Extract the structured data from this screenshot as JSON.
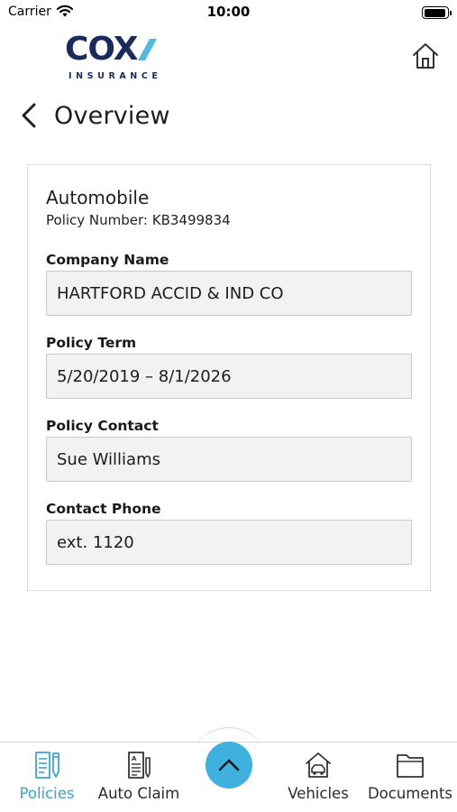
{
  "status_bar": {
    "carrier": "Carrier",
    "time": "10:00"
  },
  "brand": {
    "name": "COX",
    "sub": "INSURANCE",
    "primary_color": "#1b2a5e",
    "accent_color": "#3fb1de"
  },
  "header": {
    "back_icon": "chevron-left-icon",
    "title": "Overview",
    "home_icon": "home-icon"
  },
  "policy": {
    "type": "Automobile",
    "number_label": "Policy Number:",
    "number": "KB3499834",
    "fields": [
      {
        "label": "Company Name",
        "value": "HARTFORD ACCID & IND CO"
      },
      {
        "label": "Policy Term",
        "value": "5/20/2019 – 8/1/2026"
      },
      {
        "label": "Policy Contact",
        "value": "Sue Williams"
      },
      {
        "label": "Contact Phone",
        "value": "ext. 1120"
      }
    ]
  },
  "tab_bar": {
    "tabs": [
      {
        "label": "Policies",
        "icon": "policies-icon",
        "active": true
      },
      {
        "label": "Auto Claim",
        "icon": "auto-claim-icon",
        "active": false
      },
      {
        "label": "Vehicles",
        "icon": "vehicles-icon",
        "active": false
      },
      {
        "label": "Documents",
        "icon": "documents-icon",
        "active": false
      }
    ],
    "center_icon": "chevron-up-icon",
    "active_color": "#3aa5d4"
  }
}
